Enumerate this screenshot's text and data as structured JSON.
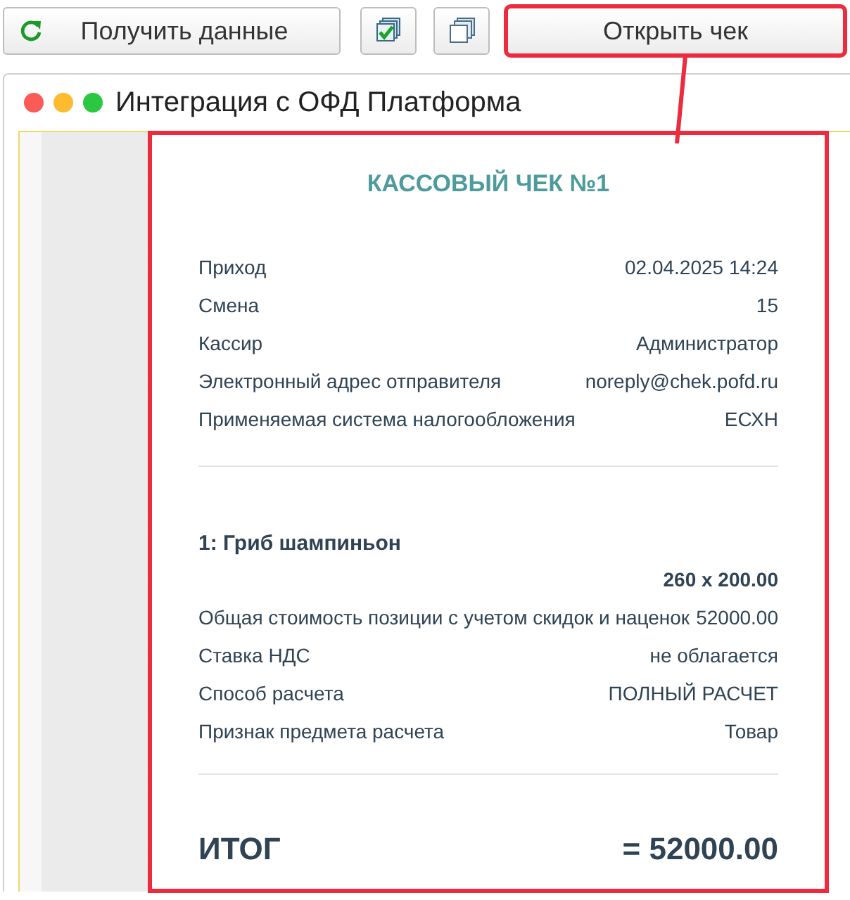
{
  "toolbar": [
    {
      "kind": "refresh",
      "label": "Получить данные",
      "highlighted": false
    },
    {
      "kind": "check-all",
      "highlighted": false
    },
    {
      "kind": "copy",
      "highlighted": false
    },
    {
      "kind": "text",
      "label": "Открыть чек",
      "highlighted": true
    }
  ],
  "window": {
    "title": "Интеграция с ОФД Платформа"
  },
  "receipt": {
    "highlighted": true,
    "title": "КАССОВЫЙ ЧЕК №1",
    "header_rows": [
      {
        "label": "Приход",
        "value": "02.04.2025 14:24"
      },
      {
        "label": "Смена",
        "value": "15"
      },
      {
        "label": "Кассир",
        "value": "Администратор"
      },
      {
        "label": "Электронный адрес отправителя",
        "value": "noreply@chek.pofd.ru"
      },
      {
        "label": "Применяемая система налогообложения",
        "value": "ЕСХН"
      }
    ],
    "item": {
      "title": "1: Гриб шампиньон",
      "quantity": "260 x 200.00",
      "rows": [
        {
          "label": "Общая стоимость позиции с учетом скидок и наценок",
          "value": "52000.00"
        },
        {
          "label": "Ставка НДС",
          "value": "не облагается"
        },
        {
          "label": "Способ расчета",
          "value": "ПОЛНЫЙ РАСЧЕТ"
        },
        {
          "label": "Признак предмета расчета",
          "value": "Товар"
        }
      ]
    },
    "total": {
      "label": "ИТОГ",
      "value": "= 52000.00"
    }
  }
}
